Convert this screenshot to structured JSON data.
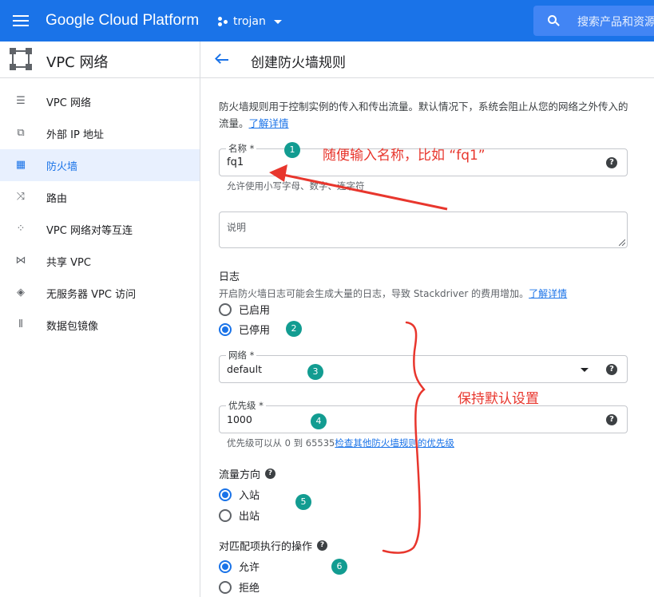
{
  "topbar": {
    "product": "Google Cloud Platform",
    "project": "trojan",
    "search_placeholder": "搜索产品和资源"
  },
  "sidebar": {
    "title": "VPC 网络",
    "items": [
      {
        "label": "VPC 网络",
        "icon": "vpc-network-icon"
      },
      {
        "label": "外部 IP 地址",
        "icon": "external-ip-icon"
      },
      {
        "label": "防火墙",
        "icon": "firewall-icon",
        "active": true
      },
      {
        "label": "路由",
        "icon": "routes-icon"
      },
      {
        "label": "VPC 网络对等互连",
        "icon": "peering-icon"
      },
      {
        "label": "共享 VPC",
        "icon": "shared-vpc-icon"
      },
      {
        "label": "无服务器 VPC 访问",
        "icon": "serverless-icon"
      },
      {
        "label": "数据包镜像",
        "icon": "packet-mirroring-icon"
      }
    ]
  },
  "main": {
    "title": "创建防火墙规则",
    "description": "防火墙规则用于控制实例的传入和传出流量。默认情况下，系统会阻止从您的网络之外传入的流量。",
    "learn_more": "了解详情",
    "name_field": {
      "label": "名称 *",
      "value": "fq1",
      "hint": "允许使用小写字母、数字、连字符"
    },
    "description_field": {
      "placeholder": "说明"
    },
    "logs": {
      "title": "日志",
      "subtext": "开启防火墙日志可能会生成大量的日志，导致 Stackdriver 的费用增加。",
      "learn_more": "了解详情",
      "on_label": "已启用",
      "off_label": "已停用"
    },
    "network_field": {
      "label": "网络 *",
      "value": "default"
    },
    "priority_field": {
      "label": "优先级 *",
      "value": "1000",
      "hint": "优先级可以从 0 到 65535",
      "hint_link": "检查其他防火墙规则的优先级"
    },
    "direction": {
      "title": "流量方向",
      "ingress": "入站",
      "egress": "出站"
    },
    "action": {
      "title": "对匹配项执行的操作",
      "allow": "允许",
      "deny": "拒绝"
    }
  },
  "annotations": {
    "badges": [
      "1",
      "2",
      "3",
      "4",
      "5",
      "6"
    ],
    "name_tip": "随便输入名称，比如 “fq1”",
    "default_tip": "保持默认设置",
    "color": "#e8362d"
  },
  "colors": {
    "primary": "#1a73e8",
    "badge": "#129c91"
  }
}
